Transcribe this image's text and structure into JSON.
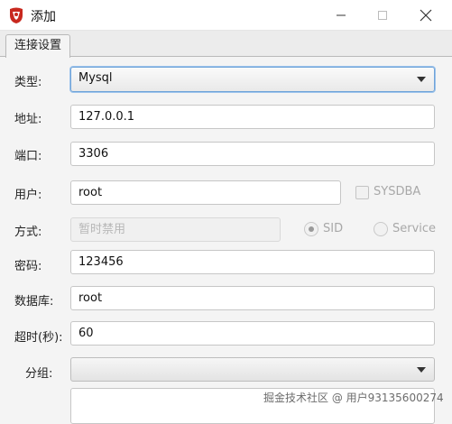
{
  "window": {
    "title": "添加",
    "minimize_icon": "minimize-icon",
    "maximize_icon": "maximize-icon",
    "close_icon": "close-icon"
  },
  "tabs": [
    {
      "label": "连接设置",
      "selected": true
    }
  ],
  "form": {
    "type": {
      "label": "类型:",
      "value": "Mysql"
    },
    "address": {
      "label": "地址:",
      "value": "127.0.0.1"
    },
    "port": {
      "label": "端口:",
      "value": "3306"
    },
    "user": {
      "label": "用户:",
      "value": "root"
    },
    "sysdba": {
      "label": "SYSDBA",
      "checked": false
    },
    "mode": {
      "label": "方式:",
      "placeholder": "暂时禁用"
    },
    "sid": {
      "label": "SID",
      "selected": true
    },
    "service": {
      "label": "Service",
      "selected": false
    },
    "password": {
      "label": "密码:",
      "value": "123456"
    },
    "database": {
      "label": "数据库:",
      "value": "root"
    },
    "timeout": {
      "label": "超时(秒):",
      "value": "60"
    },
    "group": {
      "label": "分组:",
      "value": ""
    },
    "notes": {
      "value": ""
    }
  },
  "watermark": "掘金技术社区 @ 用户93135600274",
  "colors": {
    "focus": "#6fa3d8",
    "app_icon": "#c8281e"
  }
}
